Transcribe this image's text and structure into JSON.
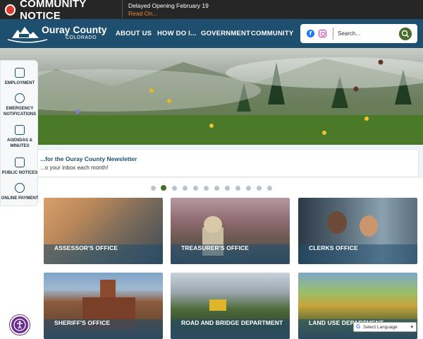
{
  "notice": {
    "title": "COMMUNITY NOTICE",
    "text": "Delayed Opening February 19",
    "link": "Read On..."
  },
  "header": {
    "logo_name": "Ouray County",
    "logo_sub": "COLORADO",
    "nav": [
      "ABOUT US",
      "HOW DO I...",
      "GOVERNMENT",
      "COMMUNITY"
    ],
    "search_placeholder": "Search..."
  },
  "newsletter": {
    "title": "...for the Ouray County Newsletter",
    "subtitle": "...o your inbox each month!"
  },
  "slider": {
    "dot_count": 12,
    "active_index": 1
  },
  "quick_links": [
    {
      "label": "EMPLOYMENT",
      "icon": "briefcase-icon"
    },
    {
      "label": "EMERGENCY NOTIFICATIONS",
      "icon": "chat-alert-icon"
    },
    {
      "label": "AGENDAS & MINUTES",
      "icon": "calendar-icon"
    },
    {
      "label": "PUBLIC NOTICES",
      "icon": "book-icon"
    },
    {
      "label": "ONLINE PAYMENT",
      "icon": "card-payment-icon"
    }
  ],
  "tiles": [
    {
      "label": "ASSESSOR'S OFFICE"
    },
    {
      "label": "TREASURER'S OFFICE"
    },
    {
      "label": "CLERKS OFFICE"
    },
    {
      "label": "SHERIFF'S OFFICE"
    },
    {
      "label": "ROAD AND BRIDGE DEPARTMENT"
    },
    {
      "label": "LAND USE DEPARTMENT"
    }
  ],
  "translate": {
    "label": "Select Language"
  },
  "colors": {
    "brand_blue": "#1f4f6e",
    "accent_green": "#4a6b2e",
    "notice_red": "#e03a2f"
  }
}
